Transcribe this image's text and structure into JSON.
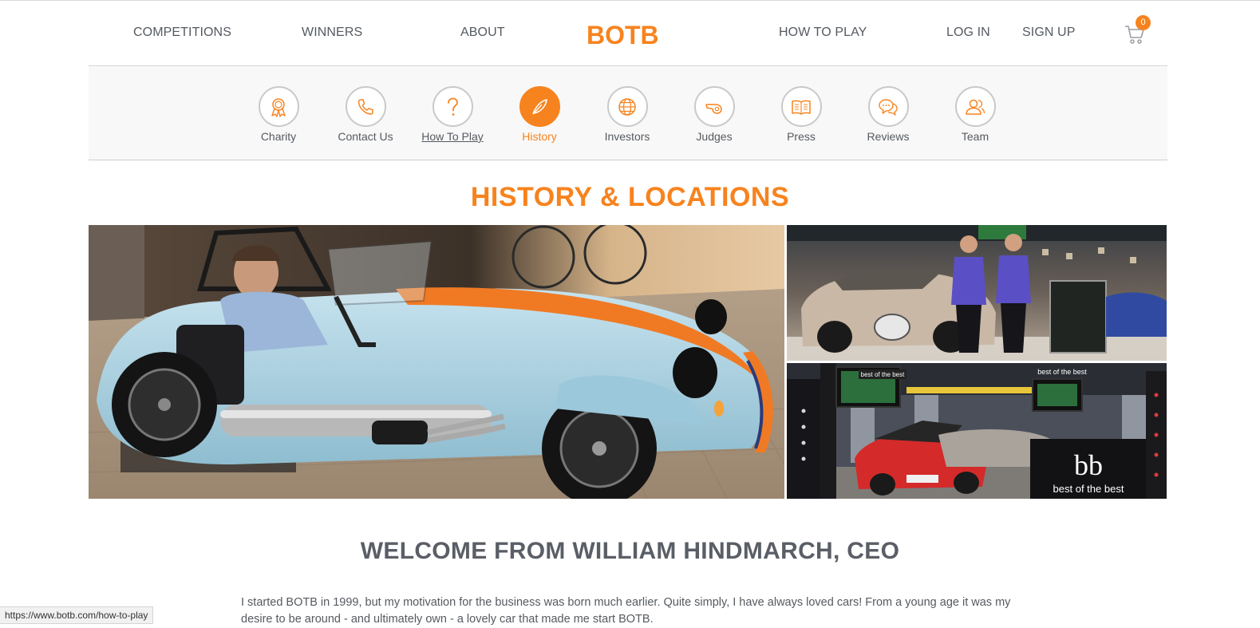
{
  "header": {
    "nav_left": [
      "COMPETITIONS",
      "WINNERS",
      "ABOUT"
    ],
    "logo_text": "BOTB",
    "nav_right": [
      "HOW TO PLAY",
      "LOG IN",
      "SIGN UP"
    ],
    "cart_count": "0"
  },
  "subnav": {
    "items": [
      {
        "label": "Charity",
        "icon": "award-ribbon-icon"
      },
      {
        "label": "Contact Us",
        "icon": "phone-icon"
      },
      {
        "label": "How To Play",
        "icon": "question-icon"
      },
      {
        "label": "History",
        "icon": "feather-icon"
      },
      {
        "label": "Investors",
        "icon": "globe-icon"
      },
      {
        "label": "Judges",
        "icon": "whistle-icon"
      },
      {
        "label": "Press",
        "icon": "open-book-icon"
      },
      {
        "label": "Reviews",
        "icon": "speech-bubbles-icon"
      },
      {
        "label": "Team",
        "icon": "people-icon"
      }
    ],
    "active_label": "History",
    "hovered_label": "How To Play"
  },
  "main": {
    "heading": "HISTORY & LOCATIONS",
    "photos": {
      "bottom_sign_text": "best of the best",
      "bottom_banner_text": "best of the best",
      "bottom_logo_text": "bb"
    },
    "welcome_heading": "WELCOME FROM WILLIAM HINDMARCH, CEO",
    "intro_text": "I started BOTB in 1999, but my motivation for the business was born much earlier. Quite simply, I have always loved cars! From a young age it was my desire to be around - and ultimately own - a lovely car that made me start BOTB."
  },
  "status_bar": {
    "url": "https://www.botb.com/how-to-play"
  },
  "colors": {
    "accent": "#f7831e",
    "text": "#555a60",
    "subnav_bg": "#f8f8f8"
  }
}
